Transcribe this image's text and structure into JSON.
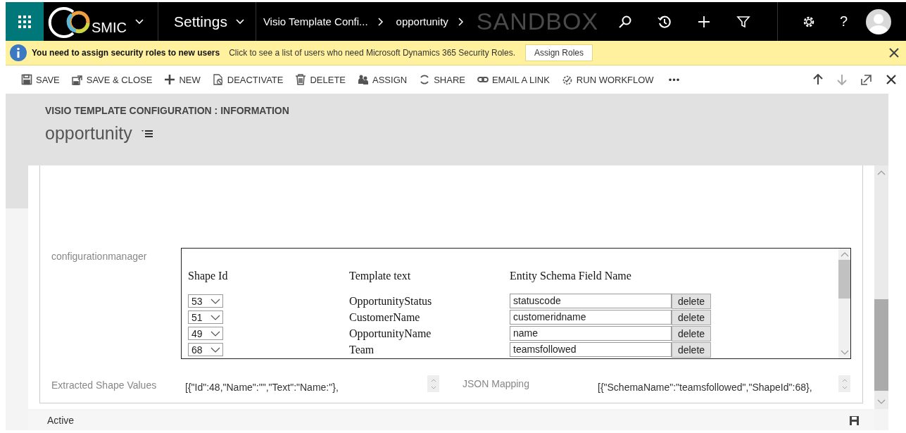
{
  "nav": {
    "logo_text": "SMIC",
    "area": "Settings",
    "breadcrumbs": [
      "Visio Template Confi...",
      "opportunity"
    ],
    "environment": "SANDBOX",
    "help": "?"
  },
  "notification": {
    "title": "You need to assign security roles to new users",
    "message": "Click to see a list of users who need Microsoft Dynamics 365 Security Roles.",
    "button": "Assign Roles"
  },
  "commands": [
    "SAVE",
    "SAVE & CLOSE",
    "NEW",
    "DEACTIVATE",
    "DELETE",
    "ASSIGN",
    "SHARE",
    "EMAIL A LINK",
    "RUN WORKFLOW"
  ],
  "more": "•••",
  "record": {
    "entity": "VISIO TEMPLATE CONFIGURATION : INFORMATION",
    "name": "opportunity"
  },
  "config": {
    "label": "configurationmanager",
    "columns": [
      "Shape Id",
      "Template text",
      "Entity Schema Field Name"
    ],
    "rows": [
      {
        "shape_id": "53",
        "template_text": "OpportunityStatus",
        "field": "statuscode",
        "button": "delete"
      },
      {
        "shape_id": "51",
        "template_text": "CustomerName",
        "field": "customeridname",
        "button": "delete"
      },
      {
        "shape_id": "49",
        "template_text": "OpportunityName",
        "field": "name",
        "button": "delete"
      },
      {
        "shape_id": "68",
        "template_text": "Team",
        "field": "teamsfollowed",
        "button": "delete"
      }
    ]
  },
  "extracted": {
    "label": "Extracted Shape Values",
    "value": "[{\"Id\":48,\"Name\":\"\",\"Text\":\"Name:\"},"
  },
  "mapping": {
    "label": "JSON Mapping",
    "value": "[{\"SchemaName\":\"teamsfollowed\",\"ShapeId\":68},"
  },
  "status_bar": {
    "status": "Active"
  }
}
